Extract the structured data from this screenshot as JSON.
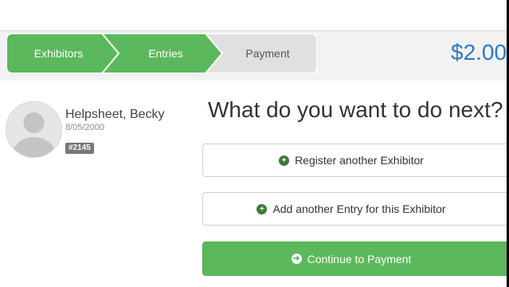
{
  "breadcrumb": {
    "steps": [
      {
        "label": "Exhibitors",
        "state": "done"
      },
      {
        "label": "Entries",
        "state": "done"
      },
      {
        "label": "Payment",
        "state": "upcoming"
      }
    ]
  },
  "cart": {
    "total": "$2.00"
  },
  "exhibitor": {
    "name": "Helpsheet, Becky",
    "dob": "8/05/2000",
    "id_badge": "#2145"
  },
  "main": {
    "heading": "What do you want to do next?",
    "buttons": {
      "register": "Register another Exhibitor",
      "add_entry": "Add another Entry for this Exhibitor",
      "continue": "Continue to Payment"
    }
  },
  "icons": {
    "plus": "plus-circle-icon",
    "arrow": "arrow-circle-right-icon"
  },
  "colors": {
    "step_done": "#5cb85c",
    "step_upcoming": "#e0e0e0",
    "total": "#2f78c0",
    "primary_button": "#5cb85c"
  }
}
